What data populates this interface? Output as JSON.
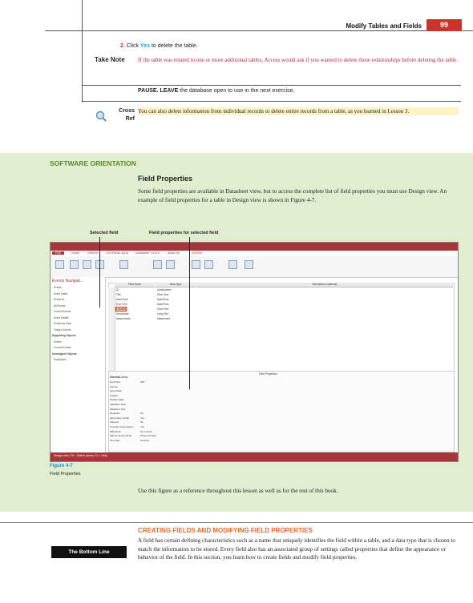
{
  "header": {
    "running_title": "Modify Tables and Fields",
    "page_number": "99"
  },
  "step2": {
    "num": "2.",
    "pre": "Click",
    "button": "Yes",
    "post": "to delete the table."
  },
  "take_note": {
    "label": "Take Note",
    "text": "If the table was related to one or more additional tables, Access would ask if you wanted to delete those relationships before deleting the table."
  },
  "pause": {
    "bold": "PAUSE. LEAVE",
    "rest": "the database open to use in the next exercise."
  },
  "cross_ref": {
    "label_line1": "Cross",
    "label_line2": "Ref",
    "text": "You can also delete information from individual records or delete entire records from a table, as you learned in Lesson 3."
  },
  "software_orientation": {
    "title": "SOFTWARE ORIENTATION",
    "subtitle": "Field Properties",
    "body": "Some field properties are available in Datasheet view, but to access the complete list of field properties you must use Design view. An example of field properties for a table in Design view is shown in Figure 4-7.",
    "callout_selected": "Selected field",
    "callout_props": "Field properties for selected field"
  },
  "screenshot": {
    "ribbon_tabs": [
      "FILE",
      "HOME",
      "CREATE",
      "EXTERNAL DATA",
      "DATABASE TOOLS",
      "ANALYZE",
      "DESIGN"
    ],
    "nav_title": "Events Navigati...",
    "nav_items": [
      "Events",
      "Event Dates",
      "Events B...",
      "All Events",
      "Current Events",
      "Event Details",
      "Events by Date",
      "Today's Events",
      "Supporting Objects",
      "Events",
      "Current Events",
      "Unassigned Objects",
      "Employees"
    ],
    "grid_headers": [
      "Field Name",
      "Data Type",
      "Description (Optional)"
    ],
    "fields": [
      [
        "ID",
        "AutoNumber"
      ],
      [
        "Title",
        "Short Text"
      ],
      [
        "Start Time",
        "Date/Time"
      ],
      [
        "End Time",
        "Date/Time"
      ],
      [
        "Location",
        "Short Text"
      ],
      [
        "Description",
        "Long Text"
      ],
      [
        "Attachments",
        "Attachment"
      ]
    ],
    "props_heading": "Field Properties",
    "prop_tabs": [
      "General",
      "Lookup"
    ],
    "props": [
      "Field Size",
      "Format",
      "Input Mask",
      "Caption",
      "Default Value",
      "Validation Rule",
      "Validation Text",
      "Required",
      "Allow Zero Length",
      "Indexed",
      "Unicode Compression",
      "IME Mode",
      "IME Sentence Mode",
      "Text Align"
    ],
    "prop_values": [
      "255",
      "",
      "",
      "",
      "",
      "",
      "",
      "No",
      "Yes",
      "No",
      "Yes",
      "No Control",
      "Phrase Predict",
      "General"
    ],
    "status": "Design view.  F6 = Switch panes.  F1 = Help."
  },
  "figure": {
    "label": "Figure 4-7",
    "caption": "Field Properties"
  },
  "use_text": "Use this figure as a reference throughout this lesson as well as for the rest of this book.",
  "creating": {
    "title": "CREATING FIELDS AND MODIFYING FIELD PROPERTIES",
    "bottom_line": "The Bottom Line",
    "body": "A field has certain defining characteristics such as a name that uniquely identifies the field within a table, and a data type that is chosen to match the information to be stored. Every field also has an associated group of settings called properties that define the appearance or behavior of the field. In this section, you learn how to create fields and modify field properties."
  },
  "colors": {
    "accent_red": "#c8362b",
    "green_bg": "#e1edcf",
    "take_note_text": "#b0293a",
    "heading_orange": "#e36a2d",
    "link_blue": "#1a8fc8"
  }
}
